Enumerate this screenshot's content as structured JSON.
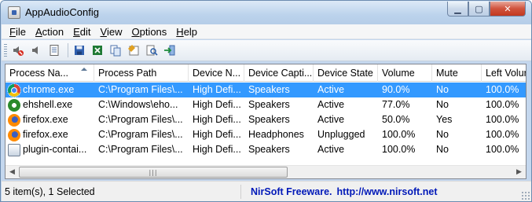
{
  "window": {
    "title": "AppAudioConfig",
    "controls": {
      "minimize": "▁",
      "maximize": "▢",
      "close": "✕"
    }
  },
  "menu": [
    {
      "accel": "F",
      "rest": "ile"
    },
    {
      "accel": "A",
      "rest": "ction"
    },
    {
      "accel": "E",
      "rest": "dit"
    },
    {
      "accel": "V",
      "rest": "iew"
    },
    {
      "accel": "O",
      "rest": "ptions"
    },
    {
      "accel": "H",
      "rest": "elp"
    }
  ],
  "toolbar": {
    "icons": [
      "mute-icon",
      "unmute-icon",
      "properties-icon",
      "save-icon",
      "excel-icon",
      "copy-icon",
      "html-report-icon",
      "find-icon",
      "exit-icon"
    ]
  },
  "columns": [
    "Process Na...",
    "Process Path",
    "Device N...",
    "Device Capti...",
    "Device State",
    "Volume",
    "Mute",
    "Left Volur"
  ],
  "rows": [
    {
      "icon": "chrome-icon",
      "process": "chrome.exe",
      "path": "C:\\Program Files\\...",
      "device_name": "High Defi...",
      "caption": "Speakers",
      "state": "Active",
      "volume": "90.0%",
      "mute": "No",
      "left": "100.0%",
      "selected": true
    },
    {
      "icon": "ehshell-icon",
      "process": "ehshell.exe",
      "path": "C:\\Windows\\eho...",
      "device_name": "High Defi...",
      "caption": "Speakers",
      "state": "Active",
      "volume": "77.0%",
      "mute": "No",
      "left": "100.0%",
      "selected": false
    },
    {
      "icon": "firefox-icon",
      "process": "firefox.exe",
      "path": "C:\\Program Files\\...",
      "device_name": "High Defi...",
      "caption": "Speakers",
      "state": "Active",
      "volume": "50.0%",
      "mute": "Yes",
      "left": "100.0%",
      "selected": false
    },
    {
      "icon": "firefox-icon",
      "process": "firefox.exe",
      "path": "C:\\Program Files\\...",
      "device_name": "High Defi...",
      "caption": "Headphones",
      "state": "Unplugged",
      "volume": "100.0%",
      "mute": "No",
      "left": "100.0%",
      "selected": false
    },
    {
      "icon": "plugin-container-icon",
      "process": "plugin-contai...",
      "path": "C:\\Program Files\\...",
      "device_name": "High Defi...",
      "caption": "Speakers",
      "state": "Active",
      "volume": "100.0%",
      "mute": "No",
      "left": "100.0%",
      "selected": false
    }
  ],
  "status": {
    "count": "5 item(s), 1 Selected",
    "brand": "NirSoft Freeware.",
    "url": "http://www.nirsoft.net"
  },
  "colors": {
    "selection": "#3399ff",
    "link": "#0018b8"
  }
}
